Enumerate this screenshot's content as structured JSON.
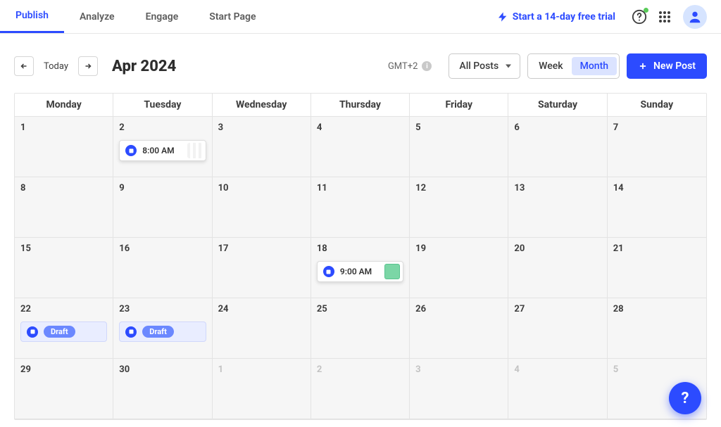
{
  "nav": {
    "tabs": [
      {
        "label": "Publish",
        "active": true
      },
      {
        "label": "Analyze",
        "active": false
      },
      {
        "label": "Engage",
        "active": false
      },
      {
        "label": "Start Page",
        "active": false
      }
    ],
    "trial_label": "Start a 14-day free trial"
  },
  "toolbar": {
    "today_label": "Today",
    "month_title": "Apr 2024",
    "timezone_label": "GMT+2",
    "filter_label": "All Posts",
    "view_week": "Week",
    "view_month": "Month",
    "active_view": "Month",
    "new_post_label": "New Post"
  },
  "calendar": {
    "day_names": [
      "Monday",
      "Tuesday",
      "Wednesday",
      "Thursday",
      "Friday",
      "Saturday",
      "Sunday"
    ],
    "weeks": [
      [
        {
          "num": "1",
          "other": false,
          "items": []
        },
        {
          "num": "2",
          "other": false,
          "items": [
            {
              "type": "event",
              "time": "8:00 AM",
              "thumb": "blank"
            }
          ]
        },
        {
          "num": "3",
          "other": false,
          "items": []
        },
        {
          "num": "4",
          "other": false,
          "items": []
        },
        {
          "num": "5",
          "other": false,
          "items": []
        },
        {
          "num": "6",
          "other": false,
          "items": []
        },
        {
          "num": "7",
          "other": false,
          "items": []
        }
      ],
      [
        {
          "num": "8",
          "other": false,
          "items": []
        },
        {
          "num": "9",
          "other": false,
          "items": []
        },
        {
          "num": "10",
          "other": false,
          "items": []
        },
        {
          "num": "11",
          "other": false,
          "items": []
        },
        {
          "num": "12",
          "other": false,
          "items": []
        },
        {
          "num": "13",
          "other": false,
          "items": []
        },
        {
          "num": "14",
          "other": false,
          "items": []
        }
      ],
      [
        {
          "num": "15",
          "other": false,
          "items": []
        },
        {
          "num": "16",
          "other": false,
          "items": []
        },
        {
          "num": "17",
          "other": false,
          "items": []
        },
        {
          "num": "18",
          "other": false,
          "items": [
            {
              "type": "event",
              "time": "9:00 AM",
              "thumb": "green"
            }
          ]
        },
        {
          "num": "19",
          "other": false,
          "items": []
        },
        {
          "num": "20",
          "other": false,
          "items": []
        },
        {
          "num": "21",
          "other": false,
          "items": []
        }
      ],
      [
        {
          "num": "22",
          "other": false,
          "items": [
            {
              "type": "draft",
              "label": "Draft"
            }
          ]
        },
        {
          "num": "23",
          "other": false,
          "items": [
            {
              "type": "draft",
              "label": "Draft"
            }
          ]
        },
        {
          "num": "24",
          "other": false,
          "items": []
        },
        {
          "num": "25",
          "other": false,
          "items": []
        },
        {
          "num": "26",
          "other": false,
          "items": []
        },
        {
          "num": "27",
          "other": false,
          "items": []
        },
        {
          "num": "28",
          "other": false,
          "items": []
        }
      ],
      [
        {
          "num": "29",
          "other": false,
          "items": []
        },
        {
          "num": "30",
          "other": false,
          "items": []
        },
        {
          "num": "1",
          "other": true,
          "items": []
        },
        {
          "num": "2",
          "other": true,
          "items": []
        },
        {
          "num": "3",
          "other": true,
          "items": []
        },
        {
          "num": "4",
          "other": true,
          "items": []
        },
        {
          "num": "5",
          "other": true,
          "items": []
        }
      ]
    ]
  },
  "fab": {
    "label": "?"
  },
  "icons": {
    "network": "social-network-icon"
  }
}
